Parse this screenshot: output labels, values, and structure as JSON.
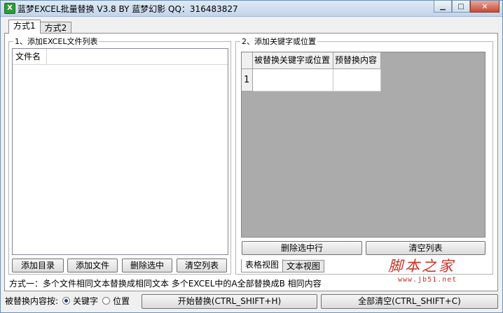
{
  "window": {
    "title": "蓝梦EXCEL批量替换 V3.8 BY 蓝梦幻影 QQ：316483827",
    "app_icon_letter": "X",
    "minimize_glyph": "▁",
    "maximize_glyph": "□",
    "close_glyph": "✕"
  },
  "tabs": [
    {
      "label": "方式1",
      "active": true
    },
    {
      "label": "方式2",
      "active": false
    }
  ],
  "left_group": {
    "title": "1、添加EXCEL文件列表",
    "list_header": "文件名",
    "buttons": {
      "add_dir": "添加目录",
      "add_file": "添加文件",
      "delete_selected": "删除选中",
      "clear_list": "清空列表"
    }
  },
  "right_group": {
    "title": "2、添加关键字或位置",
    "grid": {
      "columns": [
        "被替换关键字或位置",
        "预替换内容"
      ],
      "rows": [
        {
          "index": "1",
          "cells": [
            "",
            ""
          ]
        }
      ]
    },
    "buttons": {
      "delete_row": "删除选中行",
      "clear_list": "清空列表"
    },
    "view_tabs": [
      {
        "label": "表格视图",
        "active": true
      },
      {
        "label": "文本视图",
        "active": false
      }
    ]
  },
  "description": "方式一：多个文件相同文本替换成相同文本   多个EXCEL中的A全部替换成B 相同内容",
  "bottom": {
    "replace_by_label": "被替换内容按:",
    "options": [
      {
        "label": "关键字",
        "checked": true
      },
      {
        "label": "位置",
        "checked": false
      }
    ],
    "start_button": "开始替换(CTRL_SHIFT+H)",
    "clear_all_button": "全部清空(CTRL_SHIFT+C)"
  },
  "watermark": {
    "text": "脚本之家",
    "url": "www.jb51.net",
    "color": "#c83226"
  }
}
